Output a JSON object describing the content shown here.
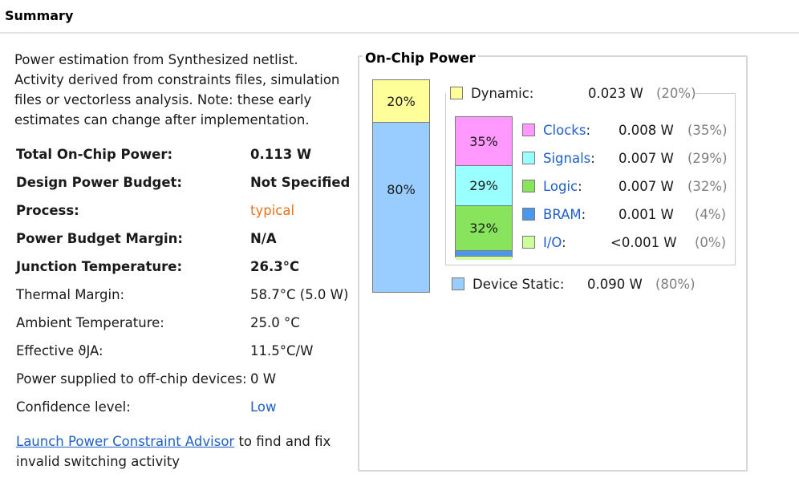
{
  "header": {
    "title": "Summary"
  },
  "intro": "Power estimation from Synthesized netlist. Activity derived from constraints files, simulation files or vectorless analysis. Note: these early estimates can change after implementation.",
  "rows": [
    {
      "label": "Total On-Chip Power:",
      "value": "0.113 W"
    },
    {
      "label": "Design Power Budget:",
      "value": "Not Specified"
    },
    {
      "label": "Process:",
      "value": "typical"
    },
    {
      "label": "Power Budget Margin:",
      "value": "N/A"
    },
    {
      "label": "Junction Temperature:",
      "value": "26.3°C"
    },
    {
      "label": "Thermal Margin:",
      "value": "58.7°C (5.0 W)"
    },
    {
      "label": "Ambient Temperature:",
      "value": "25.0 °C"
    },
    {
      "label": "Effective ϑJA:",
      "value": "11.5°C/W"
    },
    {
      "label": "Power supplied to off-chip devices:",
      "value": "0 W"
    },
    {
      "label": "Confidence level:",
      "value": "Low"
    }
  ],
  "footer": {
    "link": "Launch Power Constraint Advisor",
    "text": " to find and fix invalid switching activity"
  },
  "panel": {
    "title": "On-Chip Power",
    "dynamic": {
      "label": "Dynamic:",
      "value": "0.023 W",
      "pct": "(20%)",
      "share": 20,
      "color": "#ffff99"
    },
    "static": {
      "label": "Device Static:",
      "value": "0.090 W",
      "pct": "(80%)",
      "share": 80,
      "color": "#99ccff"
    },
    "outer_bar": {
      "top_label": "20%",
      "bottom_label": "80%"
    },
    "dynamic_items": [
      {
        "name": "Clocks",
        "value": "0.008 W",
        "pct": "(35%)",
        "share": 35,
        "color": "#ff99ff",
        "bar_label": "35%"
      },
      {
        "name": "Signals",
        "value": "0.007 W",
        "pct": "(29%)",
        "share": 29,
        "color": "#99ffff",
        "bar_label": "29%"
      },
      {
        "name": "Logic",
        "value": "0.007 W",
        "pct": "(32%)",
        "share": 32,
        "color": "#88e45c",
        "bar_label": "32%"
      },
      {
        "name": "BRAM",
        "value": "0.001 W",
        "pct": "(4%)",
        "share": 4,
        "color": "#4b97ea",
        "bar_label": ""
      },
      {
        "name": "I/O",
        "value": "<0.001 W",
        "pct": "(0%)",
        "share": 0,
        "color": "#ccff99",
        "bar_label": ""
      }
    ],
    "colon": ":"
  }
}
